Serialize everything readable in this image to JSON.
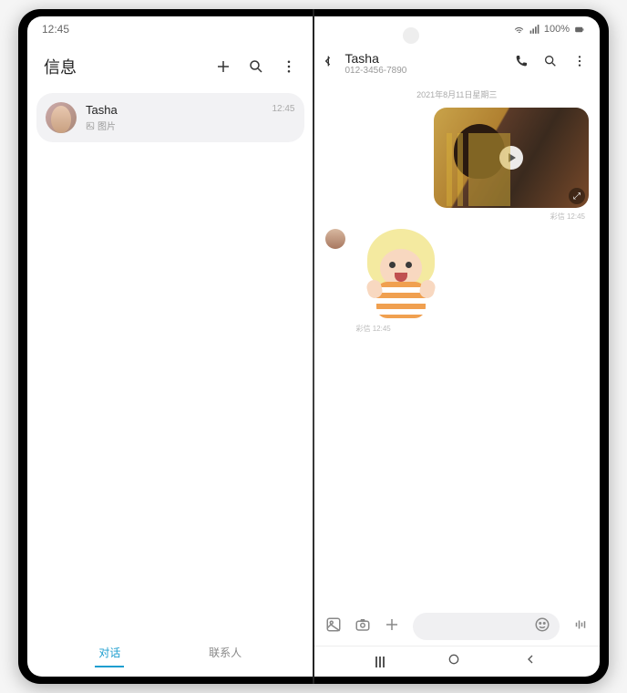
{
  "status": {
    "time": "12:45",
    "battery": "100%"
  },
  "left": {
    "title": "信息",
    "item": {
      "name": "Tasha",
      "sub": "图片",
      "time": "12:45"
    },
    "tabs": {
      "chat": "对话",
      "contacts": "联系人"
    }
  },
  "right": {
    "name": "Tasha",
    "number": "012-3456-7890",
    "date": "2021年8月11日星期三",
    "out_meta": "彩信  12:45",
    "in_meta": "彩信  12:45"
  }
}
